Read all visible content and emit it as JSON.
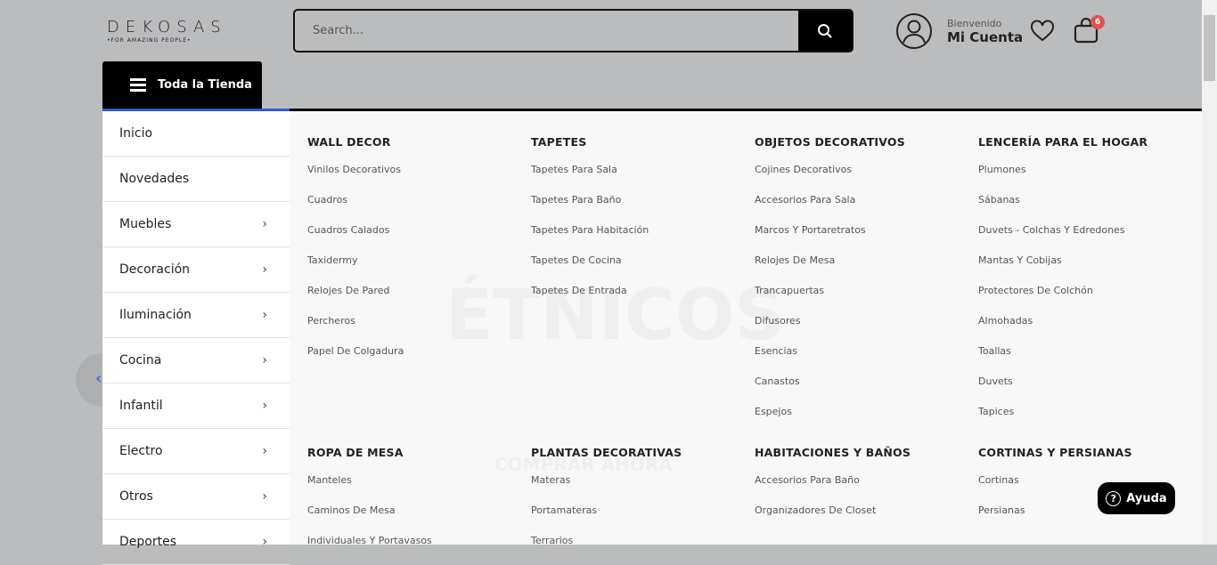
{
  "logo": {
    "title": "DEKOSAS",
    "tagline": "•FOR AMAZING PEOPLE•"
  },
  "search": {
    "placeholder": "Search...",
    "icon": "search-icon"
  },
  "account": {
    "greeting": "Bienvenido",
    "label": "Mi Cuenta"
  },
  "cart": {
    "count": "6"
  },
  "all_store": "Toda la Tienda",
  "sidebar": [
    {
      "label": "Inicio",
      "sub": false
    },
    {
      "label": "Novedades",
      "sub": false
    },
    {
      "label": "Muebles",
      "sub": true
    },
    {
      "label": "Decoración",
      "sub": true
    },
    {
      "label": "Iluminación",
      "sub": true
    },
    {
      "label": "Cocina",
      "sub": true
    },
    {
      "label": "Infantil",
      "sub": true
    },
    {
      "label": "Electro",
      "sub": true
    },
    {
      "label": "Otros",
      "sub": true
    },
    {
      "label": "Deportes",
      "sub": true
    }
  ],
  "menu": [
    {
      "title": "WALL DECOR",
      "items": [
        "Vinilos Decorativos",
        "Cuadros",
        "Cuadros Calados",
        "Taxidermy",
        "Relojes De Pared",
        "Percheros",
        "Papel De Colgadura"
      ]
    },
    {
      "title": "TAPETES",
      "items": [
        "Tapetes Para Sala",
        "Tapetes Para Baño",
        "Tapetes Para Habitación",
        "Tapetes De Cocina",
        "Tapetes De Entrada"
      ]
    },
    {
      "title": "OBJETOS DECORATIVOS",
      "items": [
        "Cojines Decorativos",
        "Accesorios Para Sala",
        "Marcos Y Portaretratos",
        "Relojes De Mesa",
        "Trancapuertas",
        "Difusores",
        "Esencias",
        "Canastos",
        "Espejos"
      ]
    },
    {
      "title": "LENCERÍA PARA EL HOGAR",
      "items": [
        "Plumones",
        "Sábanas",
        "Duvets - Colchas Y Edredones",
        "Mantas Y Cobijas",
        "Protectores De Colchón",
        "Almohadas",
        "Toallas",
        "Duvets",
        "Tapices"
      ]
    },
    {
      "title": "ROPA DE MESA",
      "items": [
        "Manteles",
        "Caminos De Mesa",
        "Individuales Y Portavasos"
      ]
    },
    {
      "title": "PLANTAS DECORATIVAS",
      "items": [
        "Materas",
        "Portamateras",
        "Terrarios"
      ]
    },
    {
      "title": "HABITACIONES Y BAÑOS",
      "items": [
        "Accesorios Para Baño",
        "Organizadores De Closet"
      ]
    },
    {
      "title": "CORTINAS Y PERSIANAS",
      "items": [
        "Cortinas",
        "Persianas"
      ]
    }
  ],
  "banner": {
    "title": "ÉTNICOS",
    "cta": "COMPRAR AHORA"
  },
  "help": "Ayuda"
}
